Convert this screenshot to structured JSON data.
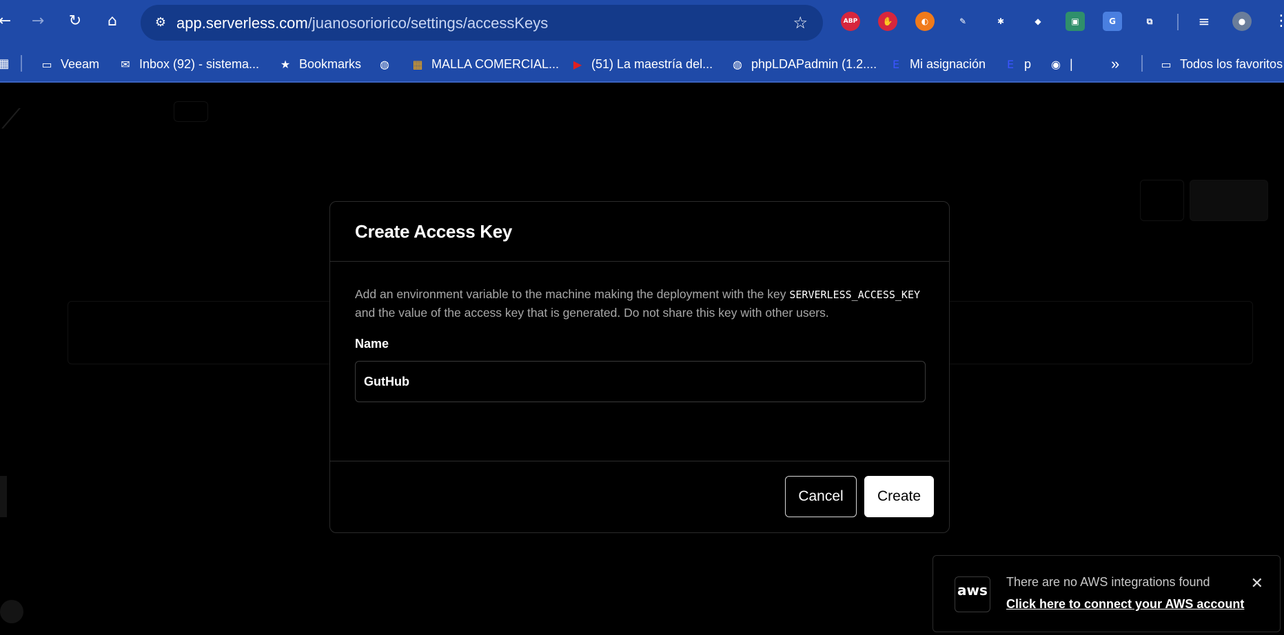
{
  "browser": {
    "url_domain": "app.serverless.com",
    "url_path": "/juanosoriorico/settings/accessKeys",
    "extensions": [
      {
        "name": "adblock-plus-icon",
        "label": "ABP",
        "color": "#d7263d"
      },
      {
        "name": "stop-hand-icon",
        "label": "✋",
        "color": "#d7263d"
      },
      {
        "name": "orange-extension-icon",
        "label": "◐",
        "color": "#f07a1a"
      },
      {
        "name": "eyedropper-icon",
        "label": "✎",
        "color": "transparent"
      },
      {
        "name": "bug-extension-icon",
        "label": "✱",
        "color": "transparent"
      },
      {
        "name": "tag-extension-icon",
        "label": "◆",
        "color": "transparent"
      },
      {
        "name": "screenshot-extension-icon",
        "label": "▣",
        "color": "#2f8f6b"
      },
      {
        "name": "translate-icon",
        "label": "G",
        "color": "#4a7fe0"
      },
      {
        "name": "puzzle-icon",
        "label": "⧉",
        "color": "transparent"
      }
    ]
  },
  "bookmarks": [
    {
      "name": "bookmark-veeam",
      "icon": "folder-icon",
      "glyph": "▭",
      "label": "Veeam"
    },
    {
      "name": "bookmark-inbox",
      "icon": "gmail-icon",
      "glyph": "✉",
      "label": "Inbox (92) - sistema..."
    },
    {
      "name": "bookmark-bookmarks",
      "icon": "star-icon",
      "glyph": "★",
      "label": "Bookmarks"
    },
    {
      "name": "bookmark-globe",
      "icon": "globe-icon",
      "glyph": "◍",
      "label": ""
    },
    {
      "name": "bookmark-malla",
      "icon": "microsoft-icon",
      "glyph": "▦",
      "label": "MALLA COMERCIAL..."
    },
    {
      "name": "bookmark-youtube",
      "icon": "youtube-icon",
      "glyph": "▶",
      "label": "(51) La maestría del..."
    },
    {
      "name": "bookmark-phpldapadmin",
      "icon": "globe-icon",
      "glyph": "◍",
      "label": "phpLDAPadmin (1.2...."
    },
    {
      "name": "bookmark-mi-asignacion",
      "icon": "e-icon",
      "glyph": "E",
      "label": "Mi asignación"
    },
    {
      "name": "bookmark-p",
      "icon": "e-icon",
      "glyph": "E",
      "label": "p"
    },
    {
      "name": "bookmark-pipe",
      "icon": "wave-icon",
      "glyph": "◉",
      "label": "|"
    }
  ],
  "bookmarks_more": "»",
  "bookmarks_all": "Todos los favoritos",
  "modal": {
    "title": "Create Access Key",
    "description_before": "Add an environment variable to the machine making the deployment with the key",
    "description_code": "SERVERLESS_ACCESS_KEY",
    "description_after": "and the value of the access key that is generated. Do not share this key with other users.",
    "name_label": "Name",
    "name_value": "GutHub",
    "cancel_label": "Cancel",
    "create_label": "Create"
  },
  "toast": {
    "logo_text": "aws",
    "message": "There are no AWS integrations found",
    "link": "Click here to connect your AWS account",
    "close": "✕"
  }
}
